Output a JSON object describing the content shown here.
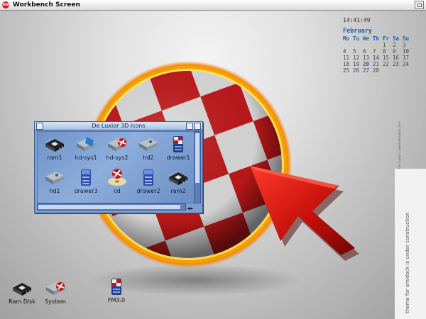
{
  "screen": {
    "title": "Workbench Screen",
    "logo_text": "AW"
  },
  "clock": "14:41:49",
  "calendar": {
    "month": "February",
    "days_of_week": [
      "Mo",
      "Tu",
      "We",
      "Th",
      "Fr",
      "Sa",
      "Su"
    ],
    "weeks": [
      [
        "",
        "",
        "",
        "",
        "1",
        "2",
        "3"
      ],
      [
        "4",
        "5",
        "6",
        "7",
        "8",
        "9",
        "10"
      ],
      [
        "11",
        "12",
        "13",
        "14",
        "15",
        "16",
        "17"
      ],
      [
        "18",
        "19",
        "20",
        "21",
        "22",
        "23",
        "24"
      ],
      [
        "25",
        "26",
        "27",
        "28",
        "",
        "",
        ""
      ]
    ],
    "today": "20"
  },
  "window": {
    "title": "De Luxior 3D Icons",
    "scroll_arrows": "◄►",
    "icons": [
      {
        "label": "ram1",
        "type": "chip"
      },
      {
        "label": "hd-sys1",
        "type": "hdd-blue"
      },
      {
        "label": "hd-sys2",
        "type": "hdd-red"
      },
      {
        "label": "hd2",
        "type": "hdd"
      },
      {
        "label": "drawer1",
        "type": "drawer-red"
      },
      {
        "label": "hd1",
        "type": "hdd"
      },
      {
        "label": "drawer3",
        "type": "drawer-blue"
      },
      {
        "label": "cd",
        "type": "cd"
      },
      {
        "label": "drawer2",
        "type": "drawer-blue"
      },
      {
        "label": "ram2",
        "type": "chip"
      }
    ]
  },
  "desktop_icons": [
    {
      "label": "Ram Disk",
      "type": "chip"
    },
    {
      "label": "System",
      "type": "hdd-red"
    },
    {
      "label": "FM3.0",
      "type": "drawer-red"
    }
  ],
  "side_panel_text": "theme for amidock is under construction",
  "side_tiny_text": "De Luxior | www.deluxior.com",
  "colors": {
    "ball_red": "#c0181a",
    "ball_white": "#e6e6e6",
    "ring": "#ffb400",
    "window_bg": "#7d9fcf",
    "accent": "#1e5ea8"
  }
}
